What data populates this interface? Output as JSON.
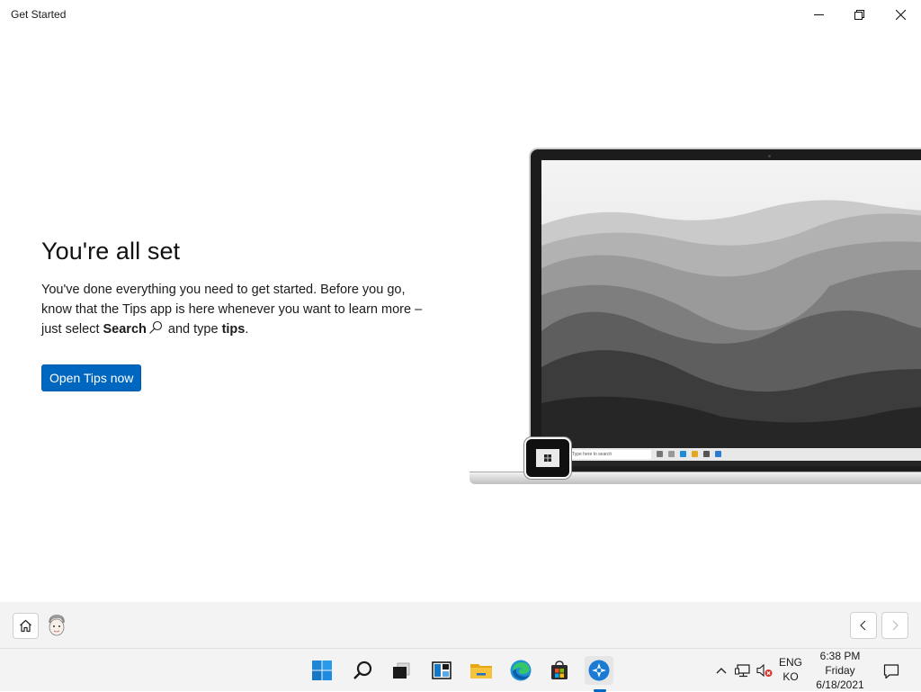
{
  "window": {
    "title": "Get Started",
    "controls": [
      "minimize-icon",
      "restore-icon",
      "close-icon"
    ]
  },
  "main": {
    "heading": "You're all set",
    "body_line1": "You've done everything you need to get started. Before you go, know that the Tips app is here whenever you want to learn more – just select ",
    "search_word": "Search",
    "body_mid": " and type ",
    "tips_word": "tips",
    "body_end": ".",
    "button_label": "Open Tips now"
  },
  "illustration": {
    "mini_search_placeholder": "Type here to search"
  },
  "navbar": {
    "home_icon": "home-icon",
    "back_icon": "chevron-left-icon",
    "forward_icon": "chevron-right-icon"
  },
  "taskbar": {
    "apps": [
      "start-icon",
      "search-icon",
      "task-view-icon",
      "widgets-icon",
      "file-explorer-icon",
      "edge-icon",
      "store-icon",
      "get-started-icon"
    ],
    "active_app": "get-started-icon",
    "lang_line1": "ENG",
    "lang_line2": "KO",
    "time": "6:38 PM",
    "day": "Friday",
    "date": "6/18/2021"
  },
  "colors": {
    "accent": "#0067c0",
    "background": "#ffffff",
    "taskbar": "#f3f3f3"
  }
}
